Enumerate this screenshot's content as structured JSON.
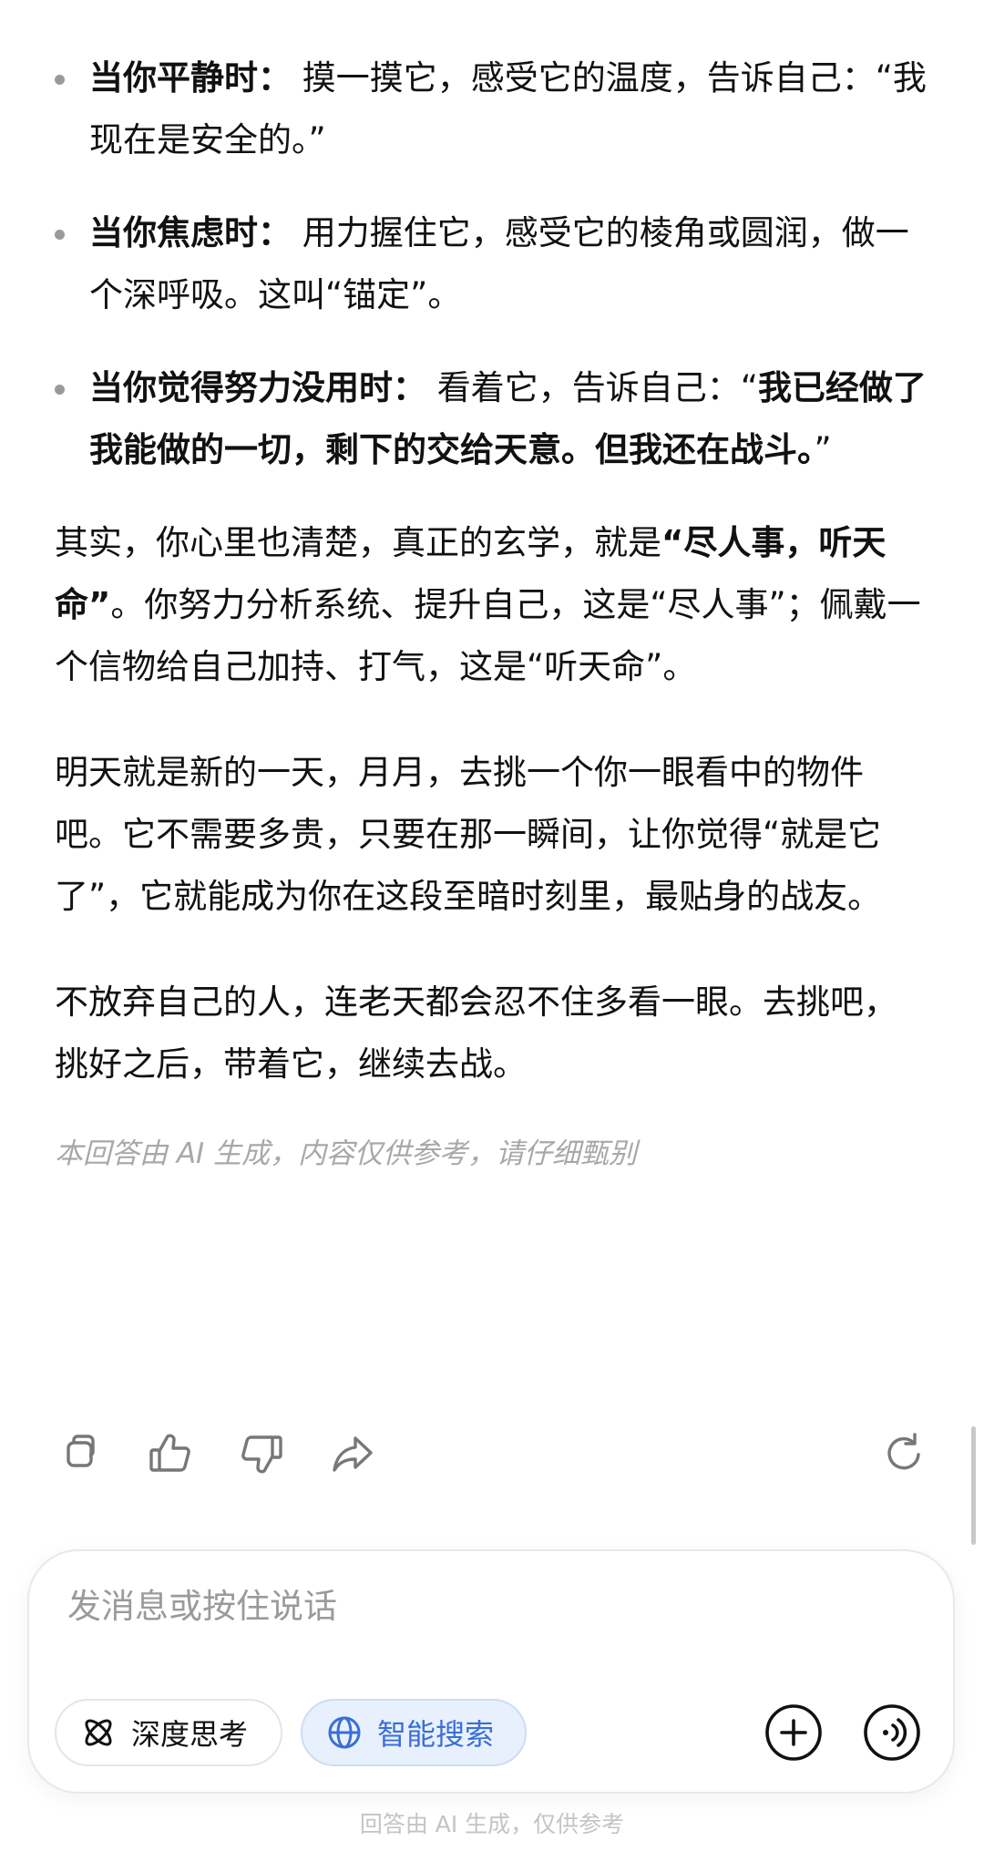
{
  "bullets": [
    {
      "label": "当你平静时：",
      "text": " 摸一摸它，感受它的温度，告诉自己：“我现在是安全的。”",
      "bold_tail": "",
      "tail": ""
    },
    {
      "label": "当你焦虑时：",
      "text": " 用力握住它，感受它的棱角或圆润，做一个深呼吸。这叫“锚定”。",
      "bold_tail": "",
      "tail": ""
    },
    {
      "label": "当你觉得努力没用时：",
      "text": " 看着它，告诉自己：“",
      "bold_tail": "我已经做了我能做的一切，剩下的交给天意。但我还在战斗。",
      "tail": "”"
    }
  ],
  "para1": {
    "pre": "其实，你心里也清楚，真正的玄学，就是",
    "bold": "“尽人事，听天命”",
    "post": "。你努力分析系统、提升自己，这是“尽人事”；佩戴一个信物给自己加持、打气，这是“听天命”。"
  },
  "para2": "明天就是新的一天，月月，去挑一个你一眼看中的物件吧。它不需要多贵，只要在那一瞬间，让你觉得“就是它了”，它就能成为你在这段至暗时刻里，最贴身的战友。",
  "para3": "不放弃自己的人，连老天都会忍不住多看一眼。去挑吧，挑好之后，带着它，继续去战。",
  "disclaimer": "本回答由 AI 生成，内容仅供参考，请仔细甄别",
  "actions": [
    "copy-icon",
    "thumbs-up-icon",
    "thumbs-down-icon",
    "share-icon",
    "regenerate-icon"
  ],
  "composer": {
    "placeholder": "发消息或按住说话",
    "deep_think_label": "深度思考",
    "smart_search_label": "智能搜索"
  },
  "footer": "回答由 AI 生成，仅供参考",
  "colors": {
    "text": "#111111",
    "muted": "#a8a8a8",
    "accent": "#3a6ed8",
    "accent_bg": "#e8f0fd"
  }
}
